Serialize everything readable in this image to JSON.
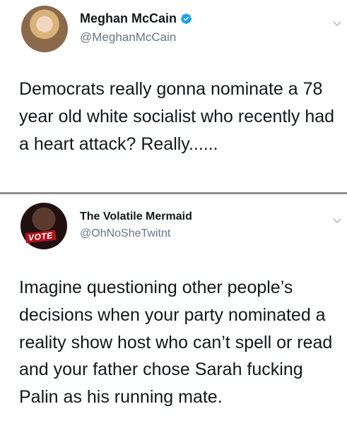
{
  "tweets": [
    {
      "display_name": "Meghan McCain",
      "handle": "@MeghanMcCain",
      "verified": true,
      "avatar_icon": "profile-photo",
      "text": "Democrats really gonna nominate a 78 year old white socialist who recently had a heart attack? Really......"
    },
    {
      "display_name": "The Volatile Mermaid",
      "handle": "@OhNoSheTwitnt",
      "verified": false,
      "avatar_icon": "profile-photo",
      "avatar_badge": "VOTE",
      "text": "Imagine questioning other people’s decisions when your party nominated a reality show host who can’t spell or read and your father chose Sarah fucking Palin as his running mate."
    }
  ],
  "colors": {
    "verified_blue": "#1da1f2",
    "handle_gray": "#657786",
    "text": "#14171a",
    "badge_red": "#b0121b"
  },
  "icons": {
    "verified": "verified-badge-icon",
    "menu": "chevron-down-icon"
  }
}
